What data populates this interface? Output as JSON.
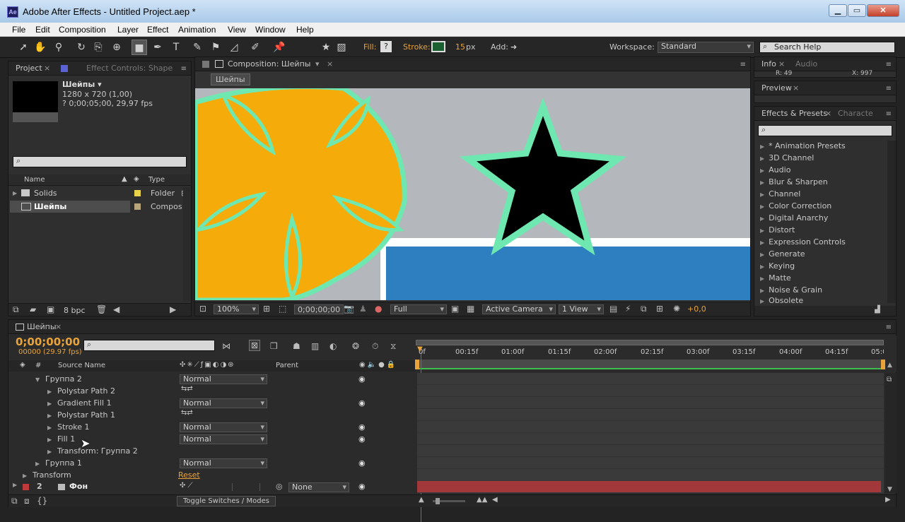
{
  "window": {
    "title": "Adobe After Effects - Untitled Project.aep *",
    "app_icon": "Ae"
  },
  "menu": [
    "File",
    "Edit",
    "Composition",
    "Layer",
    "Effect",
    "Animation",
    "View",
    "Window",
    "Help"
  ],
  "toolbar": {
    "fill_label": "Fill:",
    "fill_value": "?",
    "stroke_label": "Stroke:",
    "stroke_px": "15",
    "px_unit": "px",
    "add_label": "Add:",
    "workspace_label": "Workspace:",
    "workspace_value": "Standard",
    "search_help": "Search Help"
  },
  "project": {
    "tab": "Project",
    "effects_tab": "Effect Controls: Shape",
    "selected_name": "Шейпы ▾",
    "selected_size": "1280 x 720 (1,00)",
    "selected_duration": "? 0;00;05;00, 29,97 fps",
    "col_name": "Name",
    "col_type": "Type",
    "items": [
      {
        "name": "Solids",
        "type": "Folder",
        "color": "#e8d34a"
      },
      {
        "name": "Шейпы",
        "type": "Compos",
        "color": "#b8a57a"
      }
    ],
    "bpc": "8 bpc"
  },
  "composition": {
    "tab": "Composition: Шейпы",
    "label": "Шейпы",
    "zoom": "100%",
    "timecode": "0;00;00;00",
    "resolution": "Full",
    "camera": "Active Camera",
    "views": "1 View",
    "exposure": "+0,0"
  },
  "info": {
    "tab": "Info",
    "audio_tab": "Audio",
    "r": "R: 49",
    "x": "X: 997"
  },
  "preview": {
    "tab": "Preview"
  },
  "effects_presets": {
    "tab": "Effects & Presets",
    "char_tab": "Characte",
    "items": [
      "* Animation Presets",
      "3D Channel",
      "Audio",
      "Blur & Sharpen",
      "Channel",
      "Color Correction",
      "Digital Anarchy",
      "Distort",
      "Expression Controls",
      "Generate",
      "Keying",
      "Matte",
      "Noise & Grain",
      "Obsolete"
    ]
  },
  "timeline": {
    "tab": "Шейпы",
    "timecode": "0;00;00;00",
    "fps": "00000 (29.97 fps)",
    "col_num": "#",
    "col_source": "Source Name",
    "col_parent": "Parent",
    "ruler": [
      "0f",
      "00:15f",
      "01:00f",
      "01:15f",
      "02:00f",
      "02:15f",
      "03:00f",
      "03:15f",
      "04:00f",
      "04:15f",
      "05:0"
    ],
    "rows": [
      {
        "name": "Группа 2",
        "indent": 1,
        "mode": "Normal"
      },
      {
        "name": "Polystar Path 2",
        "indent": 2,
        "mode": ""
      },
      {
        "name": "Gradient Fill 1",
        "indent": 2,
        "mode": "Normal"
      },
      {
        "name": "Polystar Path 1",
        "indent": 2,
        "mode": ""
      },
      {
        "name": "Stroke 1",
        "indent": 2,
        "mode": "Normal"
      },
      {
        "name": "Fill 1",
        "indent": 2,
        "mode": "Normal"
      },
      {
        "name": "Transform: Группа 2",
        "indent": 2,
        "mode": ""
      },
      {
        "name": "Группа 1",
        "indent": 1,
        "mode": "Normal"
      },
      {
        "name": "Transform",
        "indent": 0,
        "mode": "Reset"
      }
    ],
    "layer2": {
      "num": "2",
      "name": "Фон",
      "parent": "None"
    },
    "toggle": "Toggle Switches / Modes"
  }
}
